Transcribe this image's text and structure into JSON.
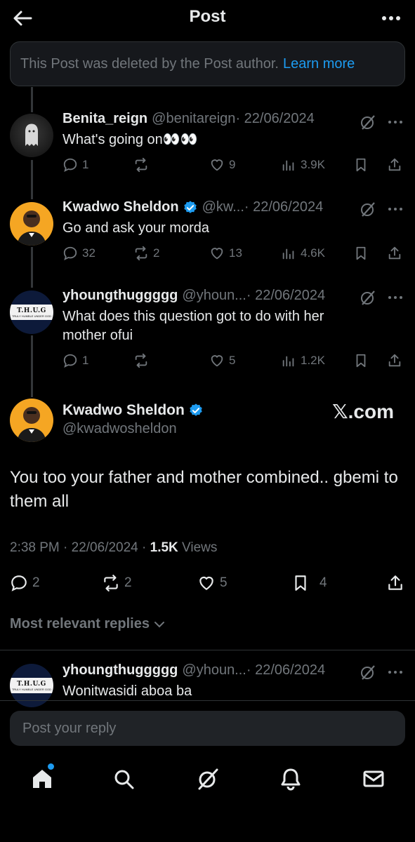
{
  "header": {
    "title": "Post"
  },
  "deleted_banner": {
    "text": "This Post was deleted by the Post author.",
    "link": "Learn more"
  },
  "replies": [
    {
      "name": "Benita_reign",
      "handle": "@benitareign",
      "date": "· 22/06/2024",
      "text": "What's going on👀👀",
      "replies": "1",
      "reposts": "",
      "likes": "9",
      "views": "3.9K",
      "verified": false
    },
    {
      "name": "Kwadwo Sheldon",
      "handle": "@kw...",
      "date": "· 22/06/2024",
      "text": "Go and ask your morda",
      "replies": "32",
      "reposts": "2",
      "likes": "13",
      "views": "4.6K",
      "verified": true
    },
    {
      "name": "yhoungthuggggg",
      "handle": "@yhoun...",
      "date": "· 22/06/2024",
      "text": "What does this question got to do with her mother ofui",
      "replies": "1",
      "reposts": "",
      "likes": "5",
      "views": "1.2K",
      "verified": false
    }
  ],
  "main_post": {
    "name": "Kwadwo Sheldon",
    "handle": "@kwadwosheldon",
    "watermark": "𝕏.com",
    "text": "You too your father and mother combined.. gbemi to them all",
    "time": "2:38 PM · 22/06/2024 · ",
    "views_count": "1.5K",
    "views_label": " Views",
    "replies": "2",
    "reposts": "2",
    "likes": "5",
    "bookmarks": "4"
  },
  "avatar_text": {
    "thug_line1": "T.H.U.G",
    "thug_line2": "TRULY HUMBLE UNDER GOD"
  },
  "relevant_label": "Most relevant replies",
  "bottom_reply": {
    "name": "yhoungthuggggg",
    "handle": "@yhoun...",
    "date": "· 22/06/2024",
    "text": "Wonitwasidi aboa ba"
  },
  "reply_box": {
    "placeholder": "Post your reply"
  },
  "nav": {
    "items": [
      "home-icon",
      "search-icon",
      "grok-icon",
      "notifications-icon",
      "messages-icon"
    ]
  },
  "colors": {
    "accent": "#1d9bf0",
    "background": "#000000",
    "muted": "#71767b"
  }
}
